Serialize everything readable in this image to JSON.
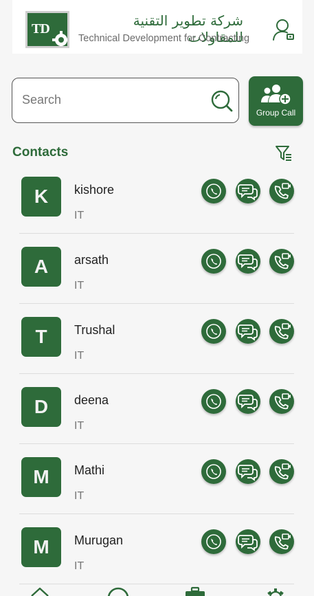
{
  "header": {
    "logo_text": "TD",
    "company_name_ar": "شركة تطوير التقنية للمقاولات",
    "company_name_en": "Technical Development for Contracting"
  },
  "search": {
    "placeholder": "Search"
  },
  "group_call": {
    "label": "Group Call"
  },
  "section": {
    "title": "Contacts"
  },
  "contacts": [
    {
      "initial": "K",
      "name": "kishore",
      "dept": "IT"
    },
    {
      "initial": "A",
      "name": "arsath",
      "dept": "IT"
    },
    {
      "initial": "T",
      "name": "Trushal",
      "dept": "IT"
    },
    {
      "initial": "D",
      "name": "deena",
      "dept": "IT"
    },
    {
      "initial": "M",
      "name": "Mathi",
      "dept": "IT"
    },
    {
      "initial": "M",
      "name": "Murugan",
      "dept": "IT"
    }
  ],
  "colors": {
    "primary": "#2e6b3a",
    "background": "#f6f6f6"
  },
  "icons": [
    "user-lock-icon",
    "search-icon",
    "group-add-icon",
    "filter-icon",
    "phone-icon",
    "chat-icon",
    "video-call-icon",
    "home-icon",
    "search-nav-icon",
    "briefcase-icon",
    "settings-icon"
  ]
}
